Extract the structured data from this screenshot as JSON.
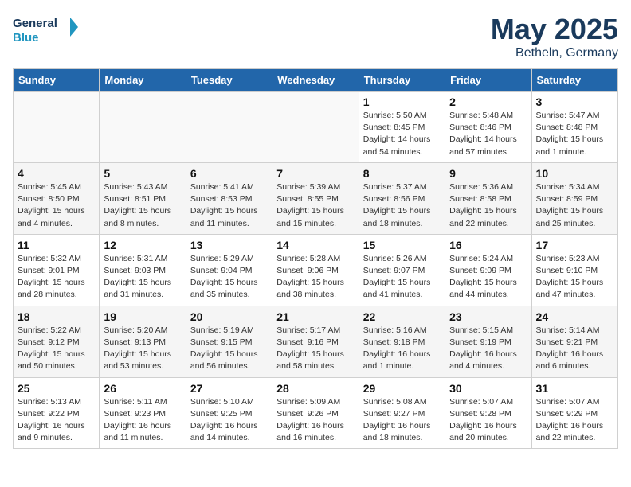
{
  "logo": {
    "text_general": "General",
    "text_blue": "Blue"
  },
  "title": "May 2025",
  "subtitle": "Betheln, Germany",
  "headers": [
    "Sunday",
    "Monday",
    "Tuesday",
    "Wednesday",
    "Thursday",
    "Friday",
    "Saturday"
  ],
  "weeks": [
    [
      {
        "day": "",
        "info": ""
      },
      {
        "day": "",
        "info": ""
      },
      {
        "day": "",
        "info": ""
      },
      {
        "day": "",
        "info": ""
      },
      {
        "day": "1",
        "info": "Sunrise: 5:50 AM\nSunset: 8:45 PM\nDaylight: 14 hours\nand 54 minutes."
      },
      {
        "day": "2",
        "info": "Sunrise: 5:48 AM\nSunset: 8:46 PM\nDaylight: 14 hours\nand 57 minutes."
      },
      {
        "day": "3",
        "info": "Sunrise: 5:47 AM\nSunset: 8:48 PM\nDaylight: 15 hours\nand 1 minute."
      }
    ],
    [
      {
        "day": "4",
        "info": "Sunrise: 5:45 AM\nSunset: 8:50 PM\nDaylight: 15 hours\nand 4 minutes."
      },
      {
        "day": "5",
        "info": "Sunrise: 5:43 AM\nSunset: 8:51 PM\nDaylight: 15 hours\nand 8 minutes."
      },
      {
        "day": "6",
        "info": "Sunrise: 5:41 AM\nSunset: 8:53 PM\nDaylight: 15 hours\nand 11 minutes."
      },
      {
        "day": "7",
        "info": "Sunrise: 5:39 AM\nSunset: 8:55 PM\nDaylight: 15 hours\nand 15 minutes."
      },
      {
        "day": "8",
        "info": "Sunrise: 5:37 AM\nSunset: 8:56 PM\nDaylight: 15 hours\nand 18 minutes."
      },
      {
        "day": "9",
        "info": "Sunrise: 5:36 AM\nSunset: 8:58 PM\nDaylight: 15 hours\nand 22 minutes."
      },
      {
        "day": "10",
        "info": "Sunrise: 5:34 AM\nSunset: 8:59 PM\nDaylight: 15 hours\nand 25 minutes."
      }
    ],
    [
      {
        "day": "11",
        "info": "Sunrise: 5:32 AM\nSunset: 9:01 PM\nDaylight: 15 hours\nand 28 minutes."
      },
      {
        "day": "12",
        "info": "Sunrise: 5:31 AM\nSunset: 9:03 PM\nDaylight: 15 hours\nand 31 minutes."
      },
      {
        "day": "13",
        "info": "Sunrise: 5:29 AM\nSunset: 9:04 PM\nDaylight: 15 hours\nand 35 minutes."
      },
      {
        "day": "14",
        "info": "Sunrise: 5:28 AM\nSunset: 9:06 PM\nDaylight: 15 hours\nand 38 minutes."
      },
      {
        "day": "15",
        "info": "Sunrise: 5:26 AM\nSunset: 9:07 PM\nDaylight: 15 hours\nand 41 minutes."
      },
      {
        "day": "16",
        "info": "Sunrise: 5:24 AM\nSunset: 9:09 PM\nDaylight: 15 hours\nand 44 minutes."
      },
      {
        "day": "17",
        "info": "Sunrise: 5:23 AM\nSunset: 9:10 PM\nDaylight: 15 hours\nand 47 minutes."
      }
    ],
    [
      {
        "day": "18",
        "info": "Sunrise: 5:22 AM\nSunset: 9:12 PM\nDaylight: 15 hours\nand 50 minutes."
      },
      {
        "day": "19",
        "info": "Sunrise: 5:20 AM\nSunset: 9:13 PM\nDaylight: 15 hours\nand 53 minutes."
      },
      {
        "day": "20",
        "info": "Sunrise: 5:19 AM\nSunset: 9:15 PM\nDaylight: 15 hours\nand 56 minutes."
      },
      {
        "day": "21",
        "info": "Sunrise: 5:17 AM\nSunset: 9:16 PM\nDaylight: 15 hours\nand 58 minutes."
      },
      {
        "day": "22",
        "info": "Sunrise: 5:16 AM\nSunset: 9:18 PM\nDaylight: 16 hours\nand 1 minute."
      },
      {
        "day": "23",
        "info": "Sunrise: 5:15 AM\nSunset: 9:19 PM\nDaylight: 16 hours\nand 4 minutes."
      },
      {
        "day": "24",
        "info": "Sunrise: 5:14 AM\nSunset: 9:21 PM\nDaylight: 16 hours\nand 6 minutes."
      }
    ],
    [
      {
        "day": "25",
        "info": "Sunrise: 5:13 AM\nSunset: 9:22 PM\nDaylight: 16 hours\nand 9 minutes."
      },
      {
        "day": "26",
        "info": "Sunrise: 5:11 AM\nSunset: 9:23 PM\nDaylight: 16 hours\nand 11 minutes."
      },
      {
        "day": "27",
        "info": "Sunrise: 5:10 AM\nSunset: 9:25 PM\nDaylight: 16 hours\nand 14 minutes."
      },
      {
        "day": "28",
        "info": "Sunrise: 5:09 AM\nSunset: 9:26 PM\nDaylight: 16 hours\nand 16 minutes."
      },
      {
        "day": "29",
        "info": "Sunrise: 5:08 AM\nSunset: 9:27 PM\nDaylight: 16 hours\nand 18 minutes."
      },
      {
        "day": "30",
        "info": "Sunrise: 5:07 AM\nSunset: 9:28 PM\nDaylight: 16 hours\nand 20 minutes."
      },
      {
        "day": "31",
        "info": "Sunrise: 5:07 AM\nSunset: 9:29 PM\nDaylight: 16 hours\nand 22 minutes."
      }
    ]
  ]
}
